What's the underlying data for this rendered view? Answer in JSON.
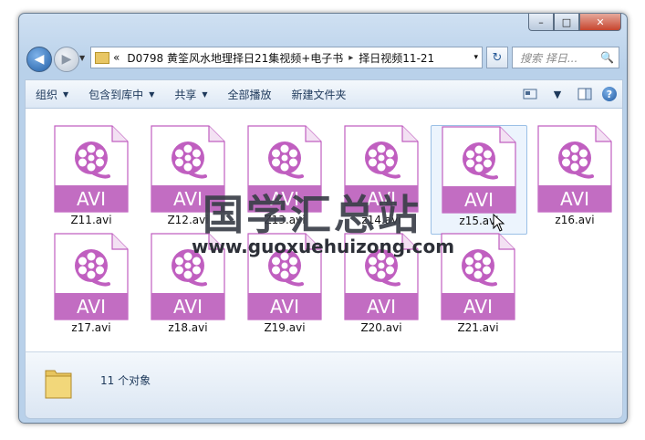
{
  "window": {
    "minimize": "–",
    "maximize": "□",
    "close": "✕"
  },
  "address": {
    "history_marker": "«",
    "path": [
      "D0798 黄筌风水地理择日21集视频+电子书",
      "择日视频11-21"
    ],
    "separator": "▸",
    "dropdown": "▾"
  },
  "nav": {
    "back_icon": "◀",
    "forward_icon": "▶",
    "history_dropdown": "▼",
    "refresh": "↻"
  },
  "search": {
    "placeholder": "搜索 择日...",
    "icon": "🔍"
  },
  "toolbar": {
    "items": [
      {
        "label": "组织",
        "arrow": "▼"
      },
      {
        "label": "包含到库中",
        "arrow": "▼"
      },
      {
        "label": "共享",
        "arrow": "▼"
      },
      {
        "label": "全部播放",
        "arrow": ""
      },
      {
        "label": "新建文件夹",
        "arrow": ""
      }
    ],
    "view_dropdown": "▼",
    "help": "?"
  },
  "files": [
    {
      "name": "Z11.avi",
      "badge": "AVI"
    },
    {
      "name": "Z12.avi",
      "badge": "AVI"
    },
    {
      "name": "Z13.avi",
      "badge": "AVI"
    },
    {
      "name": "z14.avi",
      "badge": "AVI"
    },
    {
      "name": "z15.avi",
      "badge": "AVI"
    },
    {
      "name": "z16.avi",
      "badge": "AVI"
    },
    {
      "name": "z17.avi",
      "badge": "AVI"
    },
    {
      "name": "z18.avi",
      "badge": "AVI"
    },
    {
      "name": "Z19.avi",
      "badge": "AVI"
    },
    {
      "name": "Z20.avi",
      "badge": "AVI"
    },
    {
      "name": "Z21.avi",
      "badge": "AVI"
    }
  ],
  "status": {
    "count": "11 个对象"
  },
  "watermark": {
    "title": "国学汇总站",
    "url": "www.guoxuehuizong.com"
  },
  "colors": {
    "avi_badge": "#c26dc2",
    "avi_icon": "#c05fc0"
  }
}
